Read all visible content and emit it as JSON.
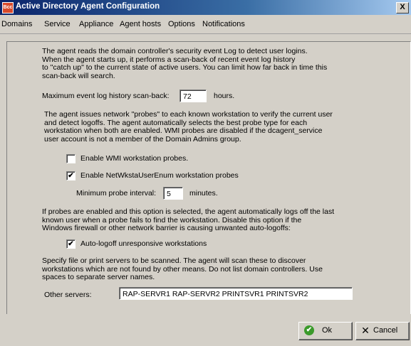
{
  "window": {
    "icon_text": "Bcc",
    "title": "Active Directory Agent Configuration",
    "close_glyph": "X"
  },
  "menu": [
    "Domains",
    "Service",
    "Appliance",
    "Agent hosts",
    "Options",
    "Notifications"
  ],
  "section1": {
    "text": "The agent reads the domain controller's security event Log to detect user logins.\n When the agent starts up, it performs a scan-back of recent event log history\nto \"catch up\" to the current state of active users.  You can limit how far back in time this\nscan-back will search.",
    "max_label": "Maximum event log history scan-back:",
    "max_value": "72",
    "max_unit": "hours."
  },
  "section2": {
    "text": "The agent issues network \"probes\" to each known workstation to verify the current user\nand detect logoffs.  The agent automatically selects the best probe type for each\nworkstation when both are enabled.  WMI probes are disabled if the dcagent_service\nuser account is not a member of the Domain Admins group.",
    "wmi_label": "Enable WMI workstation probes.",
    "wmi_checked": false,
    "netwksta_label": "Enable NetWkstaUserEnum workstation probes",
    "netwksta_checked": true,
    "interval_label": "Minimum probe interval:",
    "interval_value": "5",
    "interval_unit": "minutes."
  },
  "section3": {
    "text": "If probes are enabled and this option is selected, the agent automatically logs off the last\nknown user when a probe fails to find the workstation.  Disable this option if the\nWindows firewall or other network barrier is causing unwanted auto-logoffs:",
    "autologoff_label": "Auto-logoff unresponsive workstations",
    "autologoff_checked": true
  },
  "section4": {
    "text": "Specify file or print servers to be scanned.  The agent will scan these to discover\nworkstations which are not found by other means.  Do not list domain controllers.  Use\nspaces to separate server names.",
    "servers_label": "Other servers:",
    "servers_value": "RAP-SERVR1 RAP-SERVR2 PRINTSVR1 PRINTSVR2"
  },
  "buttons": {
    "ok": "Ok",
    "cancel": "Cancel"
  },
  "check_glyph": "✔"
}
